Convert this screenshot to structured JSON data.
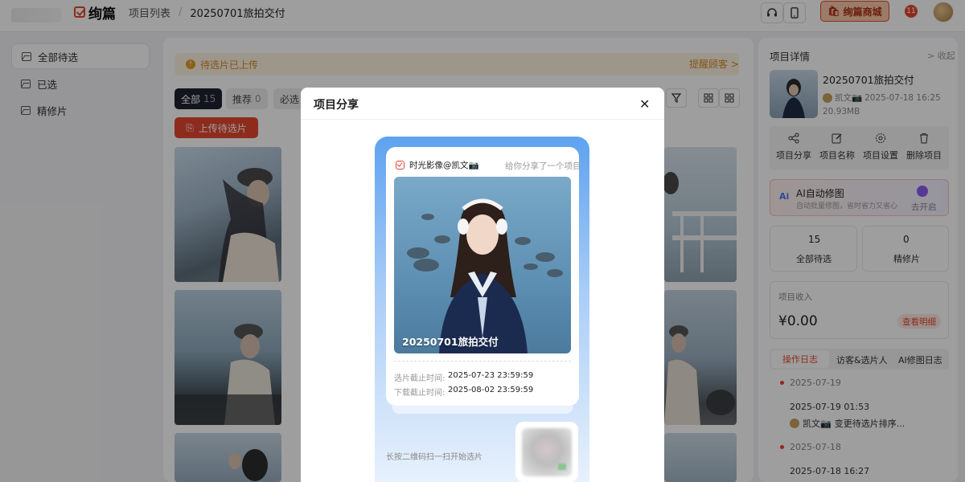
{
  "header": {
    "brand_name": "绚篇",
    "breadcrumb_root": "项目列表",
    "breadcrumb_sep": "/",
    "breadcrumb_current": "20250701旅拍交付",
    "headset_icon": "headset-icon",
    "phone_icon": "phone-icon",
    "mall_label": "绚篇商城",
    "notification_count": "11"
  },
  "sidebar": {
    "items": [
      {
        "label": "全部待选",
        "active": true
      },
      {
        "label": "已选",
        "active": false
      },
      {
        "label": "精修片",
        "active": false
      }
    ]
  },
  "main": {
    "notice_text": "待选片已上传",
    "remind_label": "提醒顾客 >",
    "tabs": [
      {
        "label": "全部",
        "count": "15",
        "active": true
      },
      {
        "label": "推荐",
        "count": "0",
        "active": false
      },
      {
        "label": "必选",
        "count": "",
        "active": false
      }
    ],
    "upload_label": "上传待选片"
  },
  "right_panel": {
    "title": "项目详情",
    "collapse_label": "> 收起",
    "project_name": "20250701旅拍交付",
    "owner": "凯文📷",
    "created": "2025-07-18 16:25",
    "size": "20.93MB",
    "actions": [
      {
        "label": "项目分享",
        "icon": "share-icon"
      },
      {
        "label": "项目名称",
        "icon": "edit-icon"
      },
      {
        "label": "项目设置",
        "icon": "gear-icon"
      },
      {
        "label": "删除项目",
        "icon": "trash-icon"
      }
    ],
    "ai": {
      "title": "AI自动修图",
      "desc": "自动批量修图，省时省力又省心",
      "action": "去开启"
    },
    "stats": [
      {
        "value": "15",
        "label": "全部待选"
      },
      {
        "value": "0",
        "label": "精修片"
      }
    ],
    "income_label": "项目收入",
    "income_value": "¥0.00",
    "income_detail": "查看明细",
    "log_tabs": [
      "操作日志",
      "访客&选片人",
      "AI修图日志"
    ],
    "logs": [
      {
        "date": "2025-07-19",
        "time": "2025-07-19 01:53",
        "user": "凯文📷",
        "action": "变更待选片排序..."
      },
      {
        "date": "2025-07-18",
        "time": "2025-07-18 16:27",
        "user": "",
        "action": ""
      }
    ]
  },
  "modal": {
    "title": "项目分享",
    "close_label": "✕",
    "share_from": "时光影像@凯文📷",
    "share_text": "给你分享了一个项目",
    "project_title": "20250701旅拍交付",
    "select_deadline_label": "选片截止时间:",
    "select_deadline_value": "2025-07-23 23:59:59",
    "download_deadline_label": "下载截止时间:",
    "download_deadline_value": "2025-08-02 23:59:59",
    "scan_hint": "长按二维码扫一扫开始选片"
  },
  "colors": {
    "accent": "#e4472f",
    "notice_bg": "#fdf3e0",
    "notice_text": "#d28a28",
    "card_gradient_top": "#5ea2f0",
    "active_tab": "#1e2330"
  }
}
